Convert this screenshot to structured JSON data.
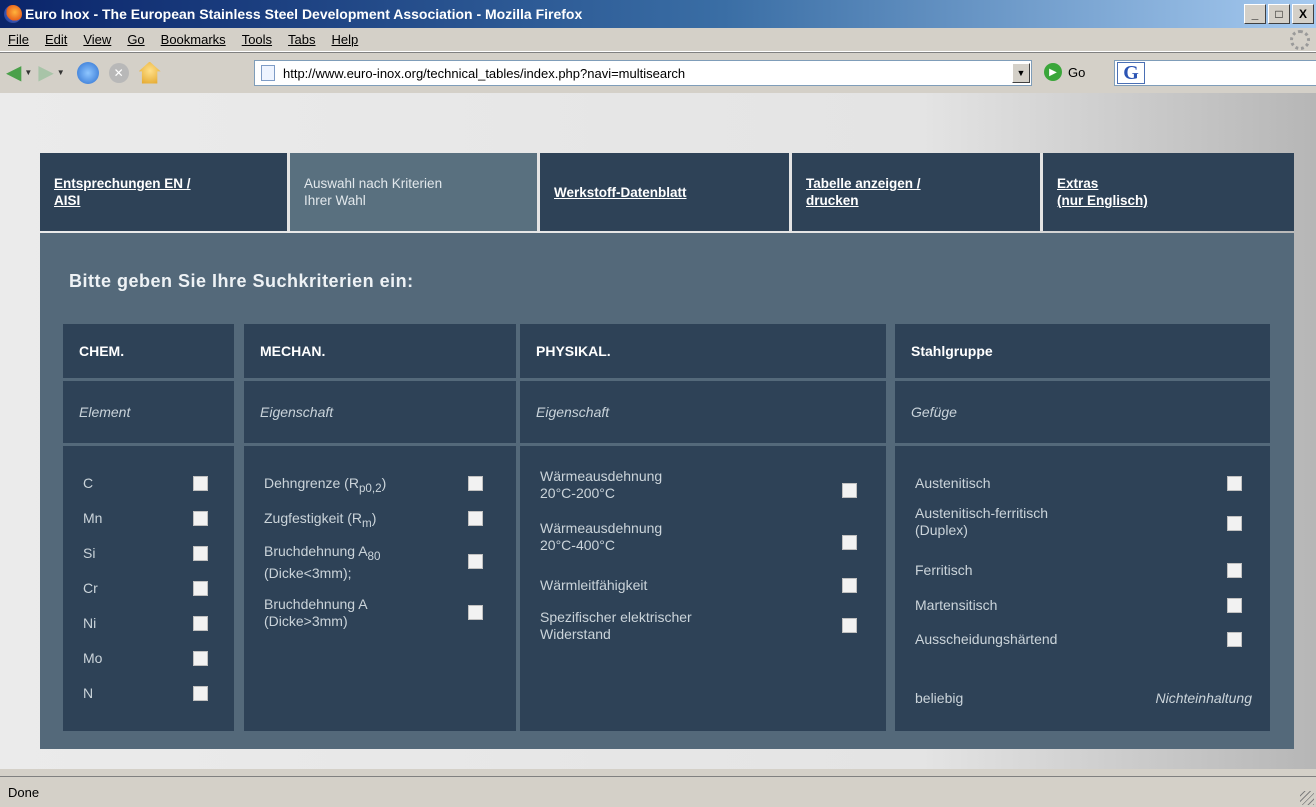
{
  "window": {
    "title": "Euro Inox - The European Stainless Steel Development Association - Mozilla Firefox",
    "controls": [
      "_",
      "□",
      "X"
    ]
  },
  "menu": [
    "File",
    "Edit",
    "View",
    "Go",
    "Bookmarks",
    "Tools",
    "Tabs",
    "Help"
  ],
  "toolbar": {
    "url": "http://www.euro-inox.org/technical_tables/index.php?navi=multisearch",
    "go_label": "Go",
    "search_logo": "G"
  },
  "tabs": [
    {
      "line1": "Entsprechungen EN /",
      "line2": "AISI"
    },
    {
      "line1": "Auswahl nach Kriterien",
      "line2": "Ihrer Wahl"
    },
    {
      "line1": "Werkstoff-Datenblatt",
      "line2": ""
    },
    {
      "line1": "Tabelle anzeigen /",
      "line2": "drucken"
    },
    {
      "line1": "Extras",
      "line2": "(nur Englisch)"
    }
  ],
  "prompt": "Bitte geben Sie Ihre Suchkriterien ein:",
  "columns": {
    "chem": {
      "header": "CHEM.",
      "subheader": "Element",
      "items": [
        "C",
        "Mn",
        "Si",
        "Cr",
        "Ni",
        "Mo",
        "N"
      ]
    },
    "mechan": {
      "header": "MECHAN.",
      "subheader": "Eigenschaft",
      "items": [
        {
          "text": "Dehngrenze (R",
          "sub": "p0,2",
          "after": ")"
        },
        {
          "text": "Zugfestigkeit (R",
          "sub": "m",
          "after": ")"
        },
        {
          "line1": "Bruchdehnung A",
          "sub": "80",
          "line2": "(Dicke<3mm);"
        },
        {
          "line1": "Bruchdehnung A",
          "line2": "(Dicke>3mm)"
        }
      ]
    },
    "physikal": {
      "header": "PHYSIKAL.",
      "subheader": "Eigenschaft",
      "items": [
        {
          "line1": "Wärmeausdehnung",
          "line2": "20°C-200°C"
        },
        {
          "line1": "Wärmeausdehnung",
          "line2": "20°C-400°C"
        },
        {
          "line1": "Wärmleitfähigkeit",
          "line2": ""
        },
        {
          "line1": "Spezifischer elektrischer",
          "line2": "Widerstand"
        }
      ]
    },
    "stahlgruppe": {
      "header": "Stahlgruppe",
      "subheader": "Gefüge",
      "items": [
        {
          "line1": "Austenitisch",
          "line2": ""
        },
        {
          "line1": "Austenitisch-ferritisch",
          "line2": "(Duplex)"
        },
        {
          "line1": "Ferritisch",
          "line2": ""
        },
        {
          "line1": "Martensitisch",
          "line2": ""
        },
        {
          "line1": "Ausscheidungshärtend",
          "line2": ""
        }
      ],
      "footer_left": "beliebig",
      "footer_right": "Nichteinhaltung"
    }
  },
  "status": "Done"
}
